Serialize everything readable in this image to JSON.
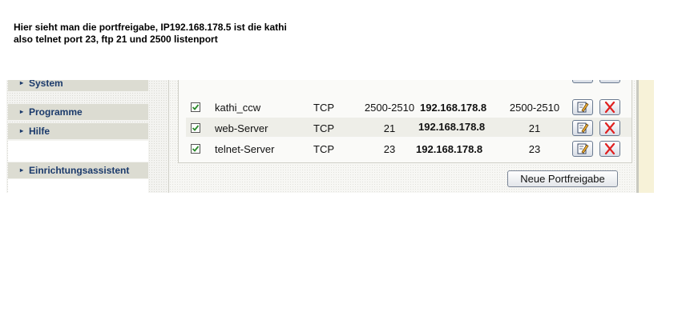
{
  "annotation": {
    "line1": "Hier sieht man die portfreigabe, IP192.168.178.5 ist die kathi",
    "line2": "also telnet port 23, ftp 21 und  2500 listenport"
  },
  "sidebar": {
    "items": [
      {
        "label": "System",
        "arrow": "▸"
      },
      {
        "label": "Programme",
        "arrow": "▸"
      },
      {
        "label": "Hilfe",
        "arrow": "▸"
      },
      {
        "label": "Einrichtungsassistent",
        "arrow": "▸"
      }
    ]
  },
  "rules": [
    {
      "enabled": true,
      "name": "kathi_ccw",
      "protocol": "TCP",
      "port": "2500-2510",
      "ip": "192.168.178.8",
      "dest_port": "2500-2510"
    },
    {
      "enabled": true,
      "name": "web-Server",
      "protocol": "TCP",
      "port": "21",
      "ip": "192.168.178.8",
      "dest_port": "21"
    },
    {
      "enabled": true,
      "name": "telnet-Server",
      "protocol": "TCP",
      "port": "23",
      "ip": "192.168.178.8",
      "dest_port": "23"
    }
  ],
  "buttons": {
    "new_rule": "Neue Portfreigabe"
  },
  "icons": {
    "edit": "edit-pencil-icon",
    "delete": "delete-x-icon",
    "checkbox": "checkmark"
  },
  "colors": {
    "sidebar_text": "#1b3a6b",
    "sidebar_bg": "#dcdcd2",
    "check": "#2b8a2b",
    "delete_x": "#e02020"
  }
}
